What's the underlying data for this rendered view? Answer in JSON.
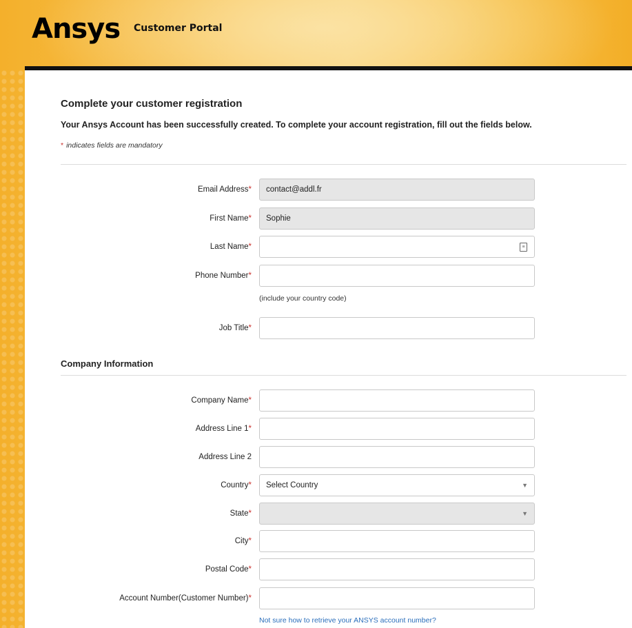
{
  "header": {
    "logo_text": "Ansys",
    "portal_title": "Customer Portal"
  },
  "form": {
    "heading": "Complete your customer registration",
    "intro": "Your Ansys Account has been successfully created. To complete your account registration, fill out the fields below.",
    "mandatory_note": "indicates fields are mandatory",
    "mandatory_star": "*",
    "personal_fields": [
      {
        "label": "Email Address",
        "required": "*",
        "value": "contact@addl.fr"
      },
      {
        "label": "First Name",
        "required": "*",
        "value": "Sophie"
      },
      {
        "label": "Last Name",
        "required": "*",
        "value": ""
      },
      {
        "label": "Phone Number",
        "required": "*",
        "value": "",
        "hint": "(include your country code)"
      },
      {
        "label": "Job Title",
        "required": "*",
        "value": ""
      }
    ],
    "company_section_title": "Company Information",
    "company_fields": [
      {
        "label": "Company Name",
        "required": "*",
        "value": ""
      },
      {
        "label": "Address Line 1",
        "required": "*",
        "value": ""
      },
      {
        "label": "Address Line 2",
        "required": "",
        "value": ""
      },
      {
        "label": "Country",
        "required": "*",
        "value": "Select Country"
      },
      {
        "label": "State",
        "required": "*",
        "value": ""
      },
      {
        "label": "City",
        "required": "*",
        "value": ""
      },
      {
        "label": "Postal Code",
        "required": "*",
        "value": ""
      },
      {
        "label": "Account Number(Customer Number)",
        "required": "*",
        "value": ""
      }
    ],
    "account_number_help_link": "Not sure how to retrieve your ANSYS account number?"
  },
  "icons": {
    "dropdown": "chevron-down-icon",
    "contact_card": "contact-card-icon"
  },
  "colors": {
    "brand_yellow": "#f6b93a",
    "required_red": "#c9302c",
    "link_blue": "#2a6ebb"
  }
}
